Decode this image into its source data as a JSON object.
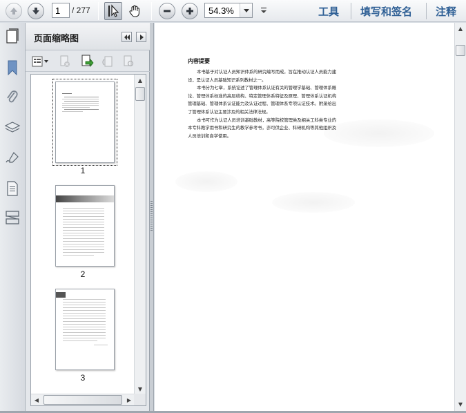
{
  "toolbar": {
    "current_page": "1",
    "total_pages": "/ 277",
    "zoom": "54.3%",
    "menus": [
      "工具",
      "填写和签名",
      "注释"
    ]
  },
  "panel": {
    "title": "页面缩略图",
    "thumbnails": [
      {
        "label": "1"
      },
      {
        "label": "2"
      },
      {
        "label": "3"
      }
    ]
  },
  "document": {
    "heading": "内容提要",
    "paragraphs": [
      "本书基于对认证人员知识体系的研究编写而成，旨在推动认证人员能力建设，是认证人员基础知识系列教材之一。",
      "本书分为七章，系统论述了管理体系认证有关的管理学基础、管理体系概论、管理体系标准的高层结构、特定管理体系特征及原理、管理体系认证机构管理基础、管理体系认证能力及认证过程、管理体系专项认证技术。附录给出了管理体系认证主要涉及的相关法律法规。",
      "本书可作为认证人员培训基础教材，高等院校管理类及相关工科类专业的本专科教学用书和研究生的教学参考书，亦可供企业、科研机构等其他组织及人员培训和自学使用。"
    ]
  },
  "colors": {
    "menu_text": "#2e5f95",
    "toolbar_bg": "#e6e9ed",
    "panel_bg": "#e4e7eb"
  },
  "icons": {
    "page_up": "arrow-up-icon",
    "page_down": "arrow-down-icon",
    "select": "cursor-arrow-icon",
    "hand": "hand-icon",
    "zoom_out": "minus-icon",
    "zoom_in": "plus-icon"
  }
}
